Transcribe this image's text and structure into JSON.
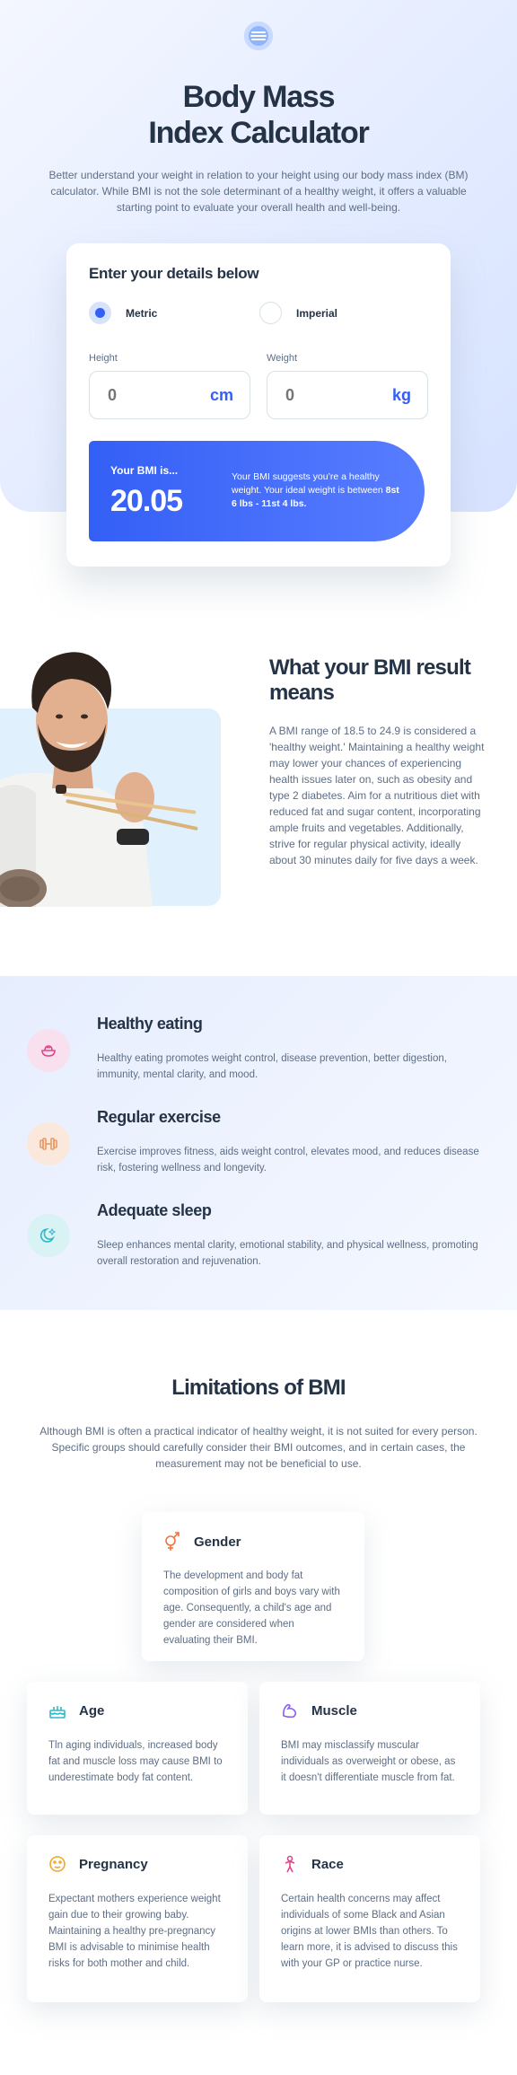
{
  "hero": {
    "title_line1": "Body Mass",
    "title_line2": "Index Calculator",
    "description": "Better understand your weight in relation to your height using our body mass index (BM) calculator. While BMI is not the sole determinant of a healthy weight, it offers a valuable starting point to evaluate your overall health and well-being."
  },
  "calculator": {
    "heading": "Enter your details below",
    "units": [
      {
        "label": "Metric",
        "checked": true
      },
      {
        "label": "Imperial",
        "checked": false
      }
    ],
    "height": {
      "label": "Height",
      "placeholder": "0",
      "unit": "cm"
    },
    "weight": {
      "label": "Weight",
      "placeholder": "0",
      "unit": "kg"
    },
    "result": {
      "label": "Your BMI is...",
      "value": "20.05",
      "text": "Your BMI suggests you’re a healthy weight. Your ideal weight is between",
      "range": "8st 6 lbs - 11st 4 lbs."
    }
  },
  "meaning": {
    "title": "What your BMI result means",
    "text": "A BMI range of 18.5 to 24.9 is considered a 'healthy weight.' Maintaining a healthy weight may lower your chances of experiencing health issues later on, such as obesity and type 2 diabetes. Aim for a nutritious diet with reduced fat and sugar content, incorporating ample fruits and vegetables. Additionally, strive for regular physical activity, ideally about 30 minutes daily for five days a week."
  },
  "tips": [
    {
      "title": "Healthy eating",
      "text": "Healthy eating promotes weight control, disease prevention, better digestion, immunity, mental clarity, and mood.",
      "icon": "bowl-icon",
      "color": "#f8e0ee"
    },
    {
      "title": "Regular exercise",
      "text": "Exercise improves fitness, aids weight control, elevates mood, and reduces disease risk, fostering wellness and longevity.",
      "icon": "dumbbell-icon",
      "color": "#fbe8dc"
    },
    {
      "title": "Adequate sleep",
      "text": "Sleep enhances mental clarity, emotional stability, and physical wellness, promoting overall restoration and rejuvenation.",
      "icon": "moon-icon",
      "color": "#d9f2f4"
    }
  ],
  "limitations": {
    "title": "Limitations of BMI",
    "description": "Although BMI is often a practical indicator of healthy weight, it is not suited for every person. Specific groups should carefully consider their BMI outcomes, and in certain cases, the measurement may not be beneficial to use.",
    "cards": [
      {
        "title": "Gender",
        "text": "The development and body fat composition of girls and boys vary with age. Consequently, a child's age and gender are considered when evaluating their BMI.",
        "icon": "gender-icon"
      },
      {
        "title": "Age",
        "text": "Tln aging individuals, increased body fat and muscle loss may cause BMI to underestimate body fat content.",
        "icon": "birthday-cake-icon"
      },
      {
        "title": "Muscle",
        "text": "BMI may misclassify muscular individuals as overweight or obese, as it doesn't differentiate muscle from fat.",
        "icon": "muscle-icon"
      },
      {
        "title": "Pregnancy",
        "text": "Expectant mothers experience weight gain due to their growing baby. Maintaining a healthy pre-pregnancy BMI is advisable to minimise health risks for both mother and child.",
        "icon": "pregnancy-icon"
      },
      {
        "title": "Race",
        "text": "Certain health concerns may affect individuals of some Black and Asian origins at lower BMIs than others. To learn more, it is advised to discuss this with your GP or practice nurse.",
        "icon": "race-icon"
      }
    ]
  },
  "colors": {
    "accent": "#345ff6",
    "text": "#253347",
    "muted": "#5e6e85",
    "border": "#d8e2e7"
  }
}
